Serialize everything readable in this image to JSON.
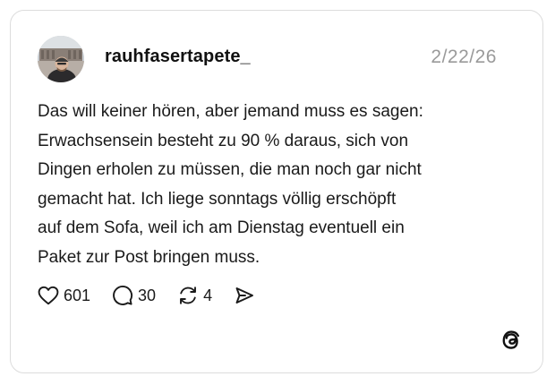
{
  "post": {
    "username": "rauhfasertapete_",
    "date": "2/22/26",
    "text_lines": [
      "Das will keiner hören, aber jemand muss es sagen:",
      "Erwachsensein besteht zu 90 % daraus, sich von",
      "Dingen erholen zu müssen, die man noch gar nicht",
      "gemacht hat. Ich liege sonntags völlig erschöpft",
      "auf dem Sofa, weil ich am Dienstag eventuell ein",
      "Paket zur Post bringen muss."
    ]
  },
  "actions": {
    "likes": "601",
    "replies": "30",
    "reposts": "4"
  },
  "icons": {
    "like": "heart-icon",
    "reply": "speech-bubble-icon",
    "repost": "repost-icon",
    "share": "send-icon",
    "brand": "threads-logo-icon"
  },
  "colors": {
    "text": "#1a1a1a",
    "date": "#9a9a9a",
    "border": "#dcdcdc"
  }
}
